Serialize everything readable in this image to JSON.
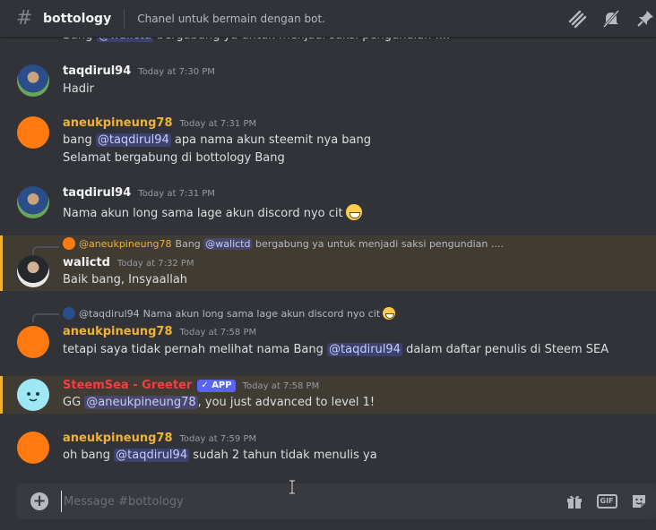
{
  "header": {
    "channel": "bottology",
    "topic": "Chanel untuk bermain dengan bot.",
    "icons": [
      "threads-icon",
      "mute-bell-icon",
      "pin-icon"
    ]
  },
  "partial_top": {
    "prefix": "Bang ",
    "mention": "@walictd",
    "suffix": " bergabung ya untuk menjadi saksi pengundian ...."
  },
  "messages": [
    {
      "user": "taqdirul94",
      "time": "Today at 7:30 PM",
      "color": "#f2f3f5",
      "lines": [
        "Hadir"
      ]
    },
    {
      "user": "aneukpineung78",
      "time": "Today at 7:31 PM",
      "color": "#f0b232",
      "line1": {
        "prefix": "bang ",
        "mention": "@taqdirul94",
        "suffix": " apa nama akun steemit nya  bang"
      },
      "line2": "Selamat bergabung di bottology Bang"
    },
    {
      "user": "taqdirul94",
      "time": "Today at 7:31 PM",
      "color": "#f2f3f5",
      "text": "Nama akun long sama lage akun discord nyo cit"
    },
    {
      "user": "walictd",
      "time": "Today at 7:32 PM",
      "color": "#f2f3f5",
      "reply": {
        "user": "@aneukpineung78",
        "prefix": "Bang ",
        "mention": "@walictd",
        "suffix": " bergabung ya untuk menjadi saksi pengundian ...."
      },
      "text": "Baik bang, Insyaallah"
    },
    {
      "user": "aneukpineung78",
      "time": "Today at 7:58 PM",
      "color": "#f0b232",
      "reply": {
        "user": "@taqdirul94",
        "text": "Nama akun long sama lage akun discord nyo cit"
      },
      "line": {
        "prefix": "tetapi saya tidak pernah melihat nama Bang ",
        "mention": "@taqdirul94",
        "suffix": "  dalam daftar penulis di Steem SEA"
      }
    },
    {
      "user": "SteemSea - Greeter",
      "time": "Today at 7:58 PM",
      "color": "#f23f43",
      "badge": "✓ APP",
      "line": {
        "prefix": "GG ",
        "mention": "@aneukpineung78",
        "suffix": ", you just advanced to level 1!"
      }
    },
    {
      "user": "aneukpineung78",
      "time": "Today at 7:59 PM",
      "color": "#f0b232",
      "line": {
        "prefix": "oh bang ",
        "mention": "@taqdirul94",
        "suffix": " sudah 2 tahun tidak menulis ya"
      }
    }
  ],
  "composer": {
    "placeholder": "Message #bottology",
    "gif_label": "GIF"
  }
}
